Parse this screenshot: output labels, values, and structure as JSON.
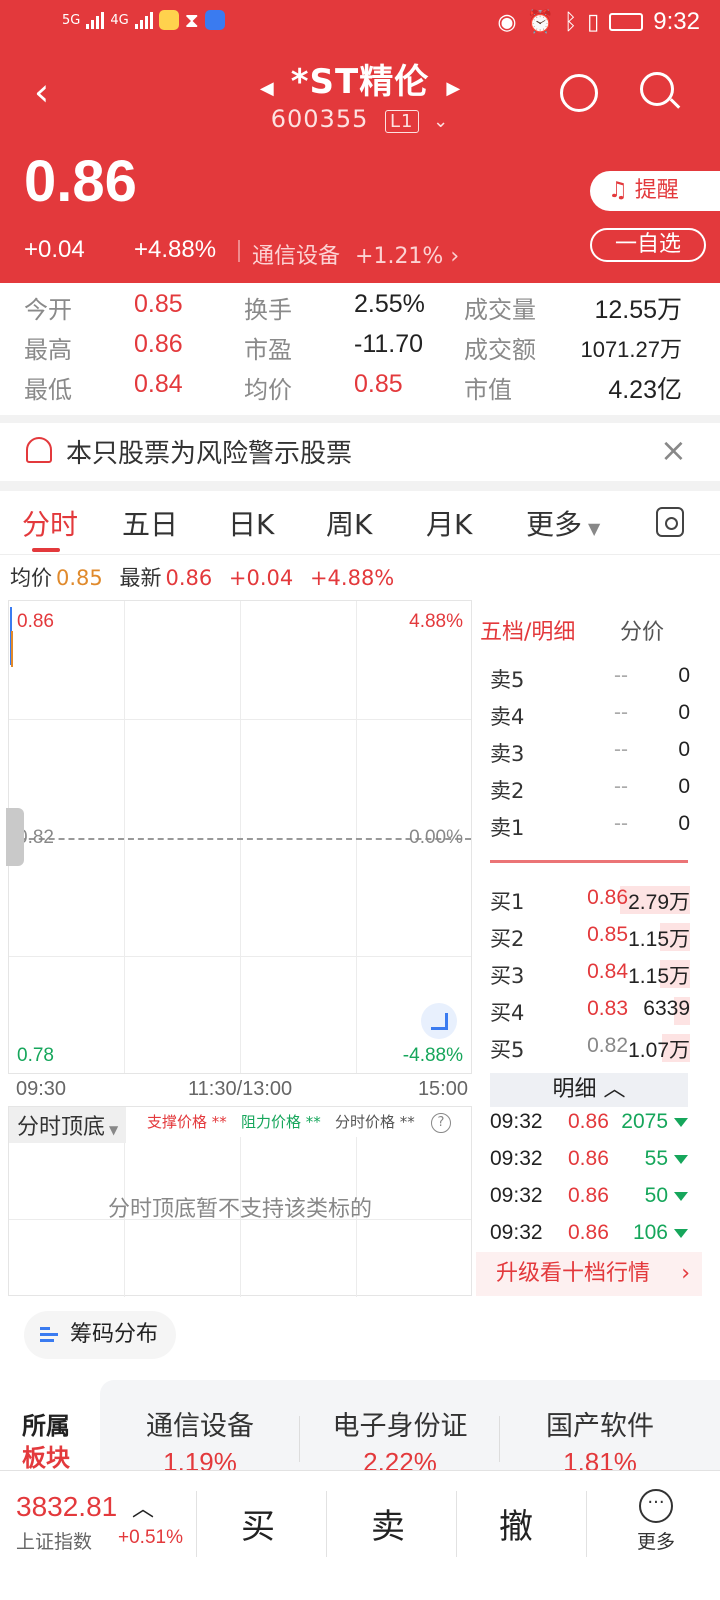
{
  "status_bar": {
    "time": "9:32",
    "network1": "5G",
    "network2": "4G"
  },
  "header": {
    "title": "*ST精伦",
    "code": "600355",
    "level": "L1"
  },
  "quote": {
    "price": "0.86",
    "change": "+0.04",
    "change_pct": "+4.88%",
    "sector_name": "通信设备",
    "sector_pct": "+1.21%",
    "remind_label": "提醒",
    "add_label": "一自选"
  },
  "stats": [
    {
      "label": "今开",
      "value": "0.85",
      "color": "red"
    },
    {
      "label": "换手",
      "value": "2.55%",
      "color": "black"
    },
    {
      "label": "成交量",
      "value": "12.55万",
      "color": "black"
    },
    {
      "label": "最高",
      "value": "0.86",
      "color": "red"
    },
    {
      "label": "市盈",
      "value": "-11.70",
      "color": "black"
    },
    {
      "label": "成交额",
      "value": "1071.27万",
      "color": "black"
    },
    {
      "label": "最低",
      "value": "0.84",
      "color": "red"
    },
    {
      "label": "均价",
      "value": "0.85",
      "color": "red"
    },
    {
      "label": "市值",
      "value": "4.23亿",
      "color": "black"
    }
  ],
  "warning": {
    "text": "本只股票为风险警示股票"
  },
  "tabs": [
    "分时",
    "五日",
    "日K",
    "周K",
    "月K",
    "更多"
  ],
  "summary": {
    "avg_label": "均价",
    "avg_value": "0.85",
    "latest_label": "最新",
    "latest_value": "0.86",
    "chg": "+0.04",
    "pct": "+4.88%"
  },
  "chart": {
    "top_price": "0.86",
    "top_pct": "4.88%",
    "mid_price": "0.82",
    "mid_pct": "0.00%",
    "bot_price": "0.78",
    "bot_pct": "-4.88%",
    "time_start": "09:30",
    "time_mid": "11:30/13:00",
    "time_end": "15:00"
  },
  "indicator": {
    "selector": "分时顶底",
    "support": "支撑价格 **",
    "resist": "阻力价格 **",
    "timeprice": "分时价格 **",
    "empty": "分时顶底暂不支持该类标的"
  },
  "orderbook": {
    "head": "五档/明细",
    "head2": "分价",
    "asks": [
      {
        "name": "卖5",
        "price": "--",
        "qty": "0"
      },
      {
        "name": "卖4",
        "price": "--",
        "qty": "0"
      },
      {
        "name": "卖3",
        "price": "--",
        "qty": "0"
      },
      {
        "name": "卖2",
        "price": "--",
        "qty": "0"
      },
      {
        "name": "卖1",
        "price": "--",
        "qty": "0"
      }
    ],
    "bids": [
      {
        "name": "买1",
        "price": "0.86",
        "qty": "2.79万",
        "pcolor": "#e3393c"
      },
      {
        "name": "买2",
        "price": "0.85",
        "qty": "1.15万",
        "pcolor": "#e3393c"
      },
      {
        "name": "买3",
        "price": "0.84",
        "qty": "1.15万",
        "pcolor": "#e3393c"
      },
      {
        "name": "买4",
        "price": "0.83",
        "qty": "6339",
        "pcolor": "#e3393c"
      },
      {
        "name": "买5",
        "price": "0.82",
        "qty": "1.07万",
        "pcolor": "#888888"
      }
    ],
    "detail_label": "明细",
    "ticks": [
      {
        "time": "09:32",
        "price": "0.86",
        "vol": "2075"
      },
      {
        "time": "09:32",
        "price": "0.86",
        "vol": "55"
      },
      {
        "time": "09:32",
        "price": "0.86",
        "vol": "50"
      },
      {
        "time": "09:32",
        "price": "0.86",
        "vol": "106"
      }
    ],
    "upgrade": "升级看十档行情"
  },
  "chip_label": "筹码分布",
  "sectors": {
    "label1": "所属",
    "label2": "板块",
    "items": [
      {
        "name": "通信设备",
        "pct": "1.19%"
      },
      {
        "name": "电子身份证",
        "pct": "2.22%"
      },
      {
        "name": "国产软件",
        "pct": "1.81%"
      }
    ]
  },
  "bottom": {
    "index_value": "3832.81",
    "index_name": "上证指数",
    "index_pct": "+0.51%",
    "buy": "买",
    "sell": "卖",
    "cancel": "撤",
    "more": "更多"
  },
  "colors": {
    "brand_red": "#e3393c",
    "down_green": "#16a65b"
  }
}
